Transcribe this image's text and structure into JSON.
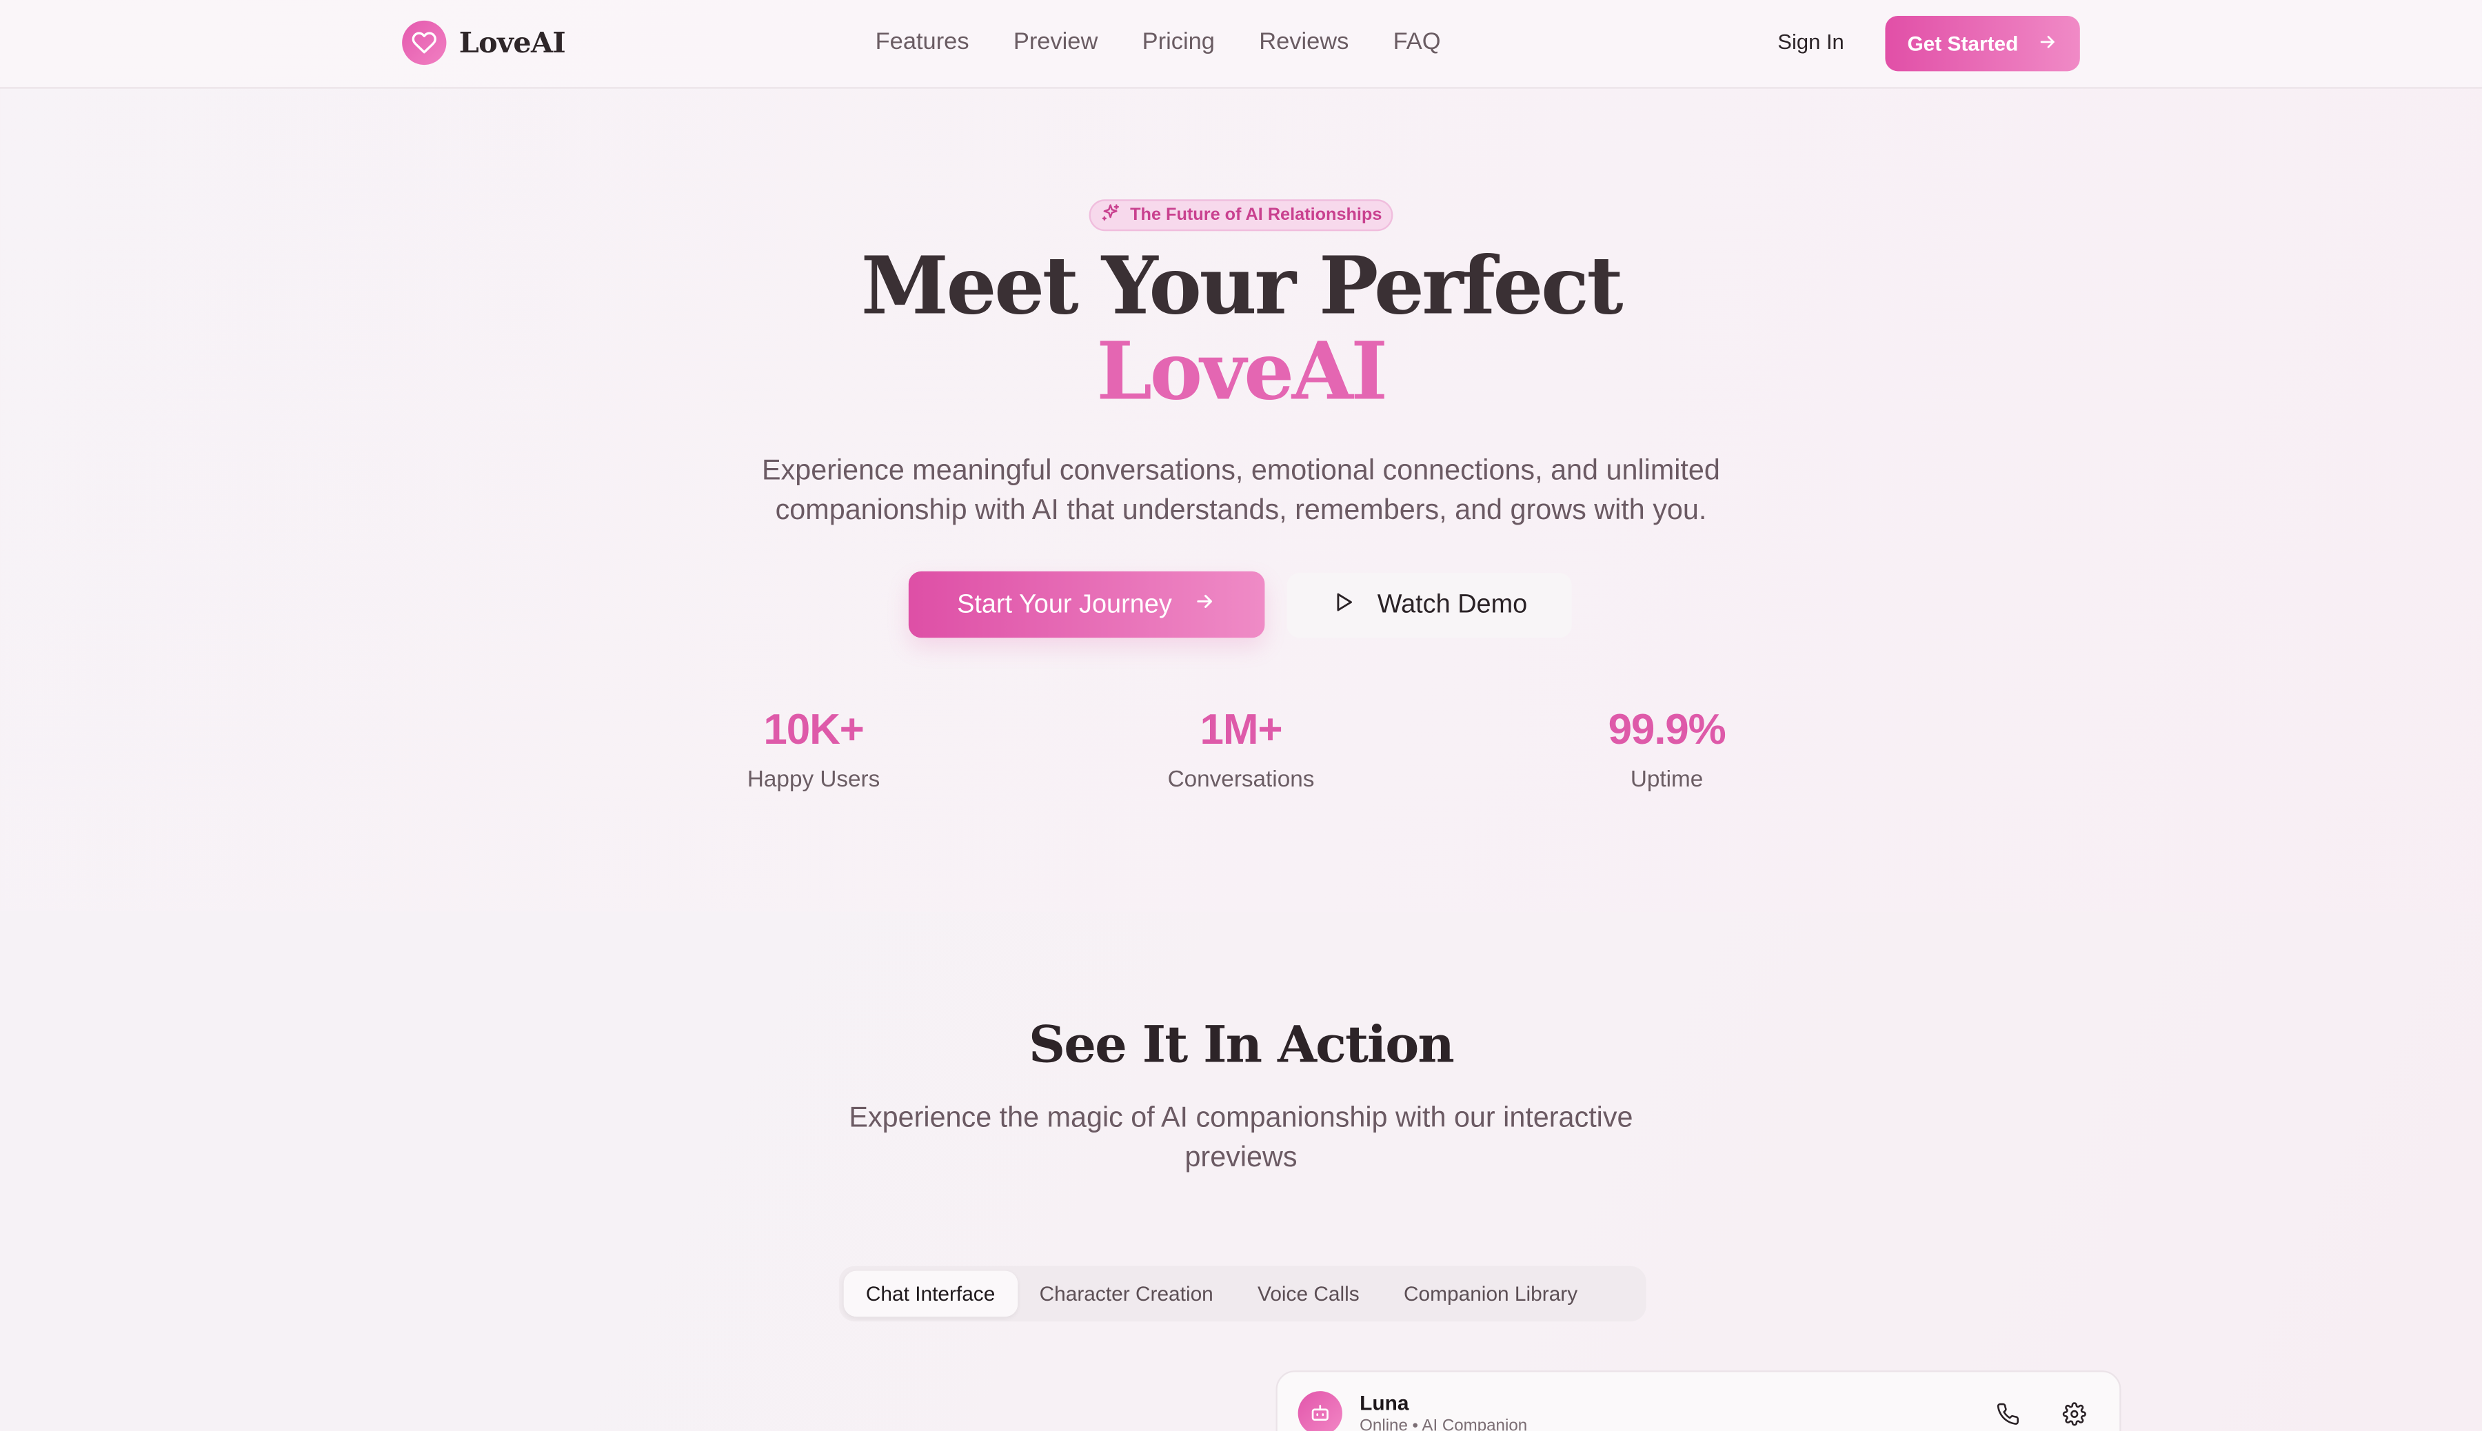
{
  "header": {
    "brand": "LoveAI",
    "nav": [
      "Features",
      "Preview",
      "Pricing",
      "Reviews",
      "FAQ"
    ],
    "sign_in": "Sign In",
    "get_started": "Get Started"
  },
  "hero": {
    "badge": "The Future of AI Relationships",
    "title_line1": "Meet Your Perfect",
    "title_line2": "LoveAI",
    "subtitle": "Experience meaningful conversations, emotional connections, and unlimited companionship with AI that understands, remembers, and grows with you.",
    "primary_cta": "Start Your Journey",
    "secondary_cta": "Watch Demo",
    "stats": [
      {
        "value": "10K+",
        "label": "Happy Users"
      },
      {
        "value": "1M+",
        "label": "Conversations"
      },
      {
        "value": "99.9%",
        "label": "Uptime"
      }
    ]
  },
  "preview": {
    "title": "See It In Action",
    "subtitle": "Experience the magic of AI companionship with our interactive previews",
    "tabs": [
      "Chat Interface",
      "Character Creation",
      "Voice Calls",
      "Companion Library"
    ],
    "active_tab": "Chat Interface",
    "chat": {
      "name": "Luna",
      "status": "Online • AI Companion"
    }
  },
  "colors": {
    "accent": "#e466b2",
    "accent_dark": "#de4fa6",
    "text_dark": "#3a3034"
  },
  "icons": [
    "heart-icon",
    "arrow-right-icon",
    "sparkles-icon",
    "play-icon",
    "bot-icon",
    "phone-icon",
    "settings-icon"
  ]
}
